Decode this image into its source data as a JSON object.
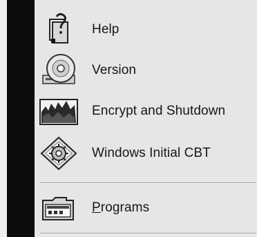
{
  "menu": {
    "items": [
      {
        "label": "Help",
        "icon": "help-book-icon"
      },
      {
        "label": "Version",
        "icon": "cd-disc-icon"
      },
      {
        "label": "Encrypt and Shutdown",
        "icon": "encrypt-shutdown-icon"
      },
      {
        "label": "Windows Initial CBT",
        "icon": "gear-diamond-icon"
      }
    ],
    "programs": {
      "label_first": "P",
      "label_rest": "rograms",
      "icon": "programs-folder-icon"
    }
  },
  "colors": {
    "menu_bg": "#e6e6e6",
    "side_strip": "#0c0c0c",
    "text": "#161616"
  }
}
